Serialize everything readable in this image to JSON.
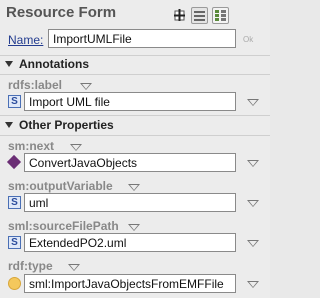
{
  "form": {
    "title": "Resource Form",
    "toolbar": {
      "add_icon": "add-property-icon",
      "list_icon": "list-view-icon",
      "grid_icon": "grid-view-icon"
    },
    "name_label": "Name:",
    "name_value": "ImportUMLFile",
    "ok_label": "Ok"
  },
  "annotations": {
    "header": "Annotations",
    "label_property": "rdfs:label",
    "label_value": "Import UML file"
  },
  "other": {
    "header": "Other Properties",
    "next_property": "sm:next",
    "next_value": "ConvertJavaObjects",
    "output_property": "sm:outputVariable",
    "output_value": "uml",
    "source_property": "sml:sourceFilePath",
    "source_value": "ExtendedPO2.uml",
    "type_property": "rdf:type",
    "type_value": "sml:ImportJavaObjectsFromEMFFile"
  },
  "icons": {
    "string_icon": "S"
  },
  "colors": {
    "link": "#233c8f",
    "resource_diamond": "#6b2e75",
    "class_circle": "#f4c85c",
    "string_icon_border": "#4a6fb5"
  }
}
